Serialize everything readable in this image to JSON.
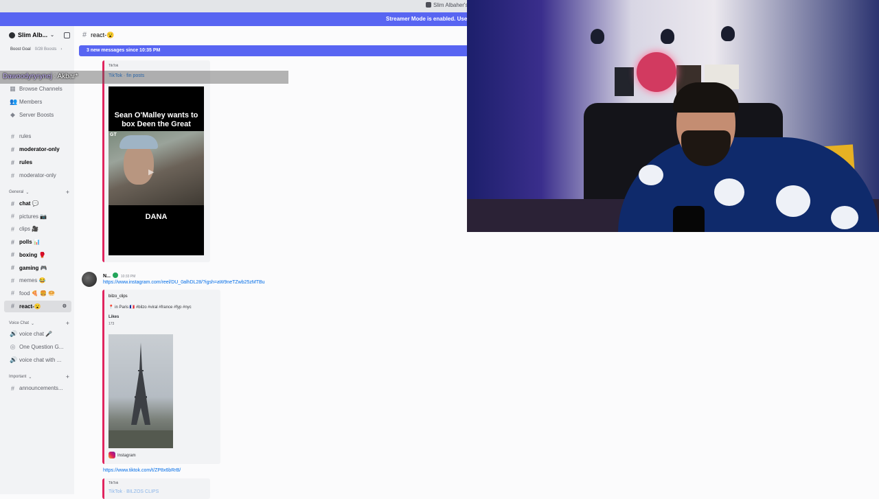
{
  "titlebar": {
    "app_label": "Slim Albaher's"
  },
  "banner": {
    "text": "Streamer Mode is enabled. Usernam"
  },
  "server": {
    "name": "Slim Alb..."
  },
  "boost": {
    "label": "Boost Goal",
    "count": "0/28 Boosts",
    "chevron": "›"
  },
  "overlay": {
    "user": "Dawoodyryrynej",
    "rest": ": Akbar*"
  },
  "sidebar": {
    "top_items": [
      {
        "label": "Browse Channels",
        "icon": "browse-icon",
        "glyph": "▦"
      },
      {
        "label": "Members",
        "icon": "members-icon",
        "glyph": "👥"
      },
      {
        "label": "Server Boosts",
        "icon": "boost-icon",
        "glyph": "◆"
      }
    ],
    "channels_a": [
      {
        "label": "rules",
        "bold": false
      },
      {
        "label": "moderator-only",
        "bold": true
      },
      {
        "label": "rules",
        "bold": true
      },
      {
        "label": "moderator-only",
        "bold": false
      }
    ],
    "category_general": "General",
    "general": [
      {
        "label": "chat 💬",
        "bold": true
      },
      {
        "label": "pictures 📷",
        "bold": false
      },
      {
        "label": "clips 🎥",
        "bold": false
      },
      {
        "label": "polls 📊",
        "bold": true
      },
      {
        "label": "boxing 🥊",
        "bold": true
      },
      {
        "label": "gaming 🎮",
        "bold": true
      },
      {
        "label": "memes 😂",
        "bold": false
      },
      {
        "label": "food 🍕 🍔 🥯",
        "bold": false
      },
      {
        "label": "react-😮",
        "bold": true,
        "active": true
      }
    ],
    "category_voice": "Voice Chat",
    "voice": [
      {
        "label": "voice chat 🎤",
        "icon": "speaker-icon",
        "glyph": "🔊"
      },
      {
        "label": "One Question G...",
        "icon": "stage-icon",
        "glyph": "◎"
      },
      {
        "label": "voice chat with ...",
        "icon": "speaker-icon",
        "glyph": "🔊"
      }
    ],
    "category_important": "Important",
    "important": [
      {
        "label": "announcements..."
      }
    ]
  },
  "channel_header": {
    "name": "react-😮"
  },
  "new_messages": "3 new messages since 10:35 PM",
  "embed1": {
    "provider": "TikTok",
    "title": "TikTok · fin posts",
    "caption_top": "Sean O'Malley wants to box Deen the Great",
    "caption_bottom": "DANA",
    "tag": "GT"
  },
  "message2": {
    "author": "N...",
    "time": "10:33 PM",
    "link": "https://www.instagram.com/reel/DU_0alhDL28/?igsh=aW9neTZwb25zMTBu",
    "embed_provider": "bilzo_clips",
    "embed_desc": "📍 in Paris 🇫🇷 #bilzo #viral #france #fyp #nyc",
    "likes_label": "Likes",
    "likes_count": "173",
    "footer": "Instagram"
  },
  "message3": {
    "link": "https://www.tiktok.com/t/ZP8x6bRrB/",
    "embed_provider": "TikTok",
    "embed_title": "TikTok · BILZOS CLIPS"
  },
  "colors": {
    "accent": "#5865f2",
    "link": "#006ce7",
    "embed_bar": "#e0245e"
  }
}
